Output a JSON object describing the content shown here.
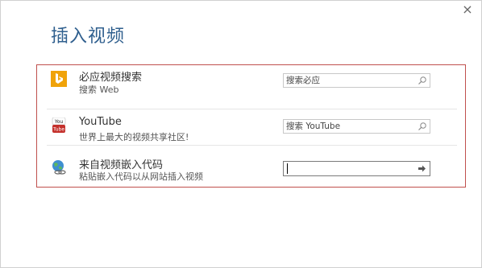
{
  "dialog": {
    "title": "插入视频",
    "close_glyph": "×"
  },
  "sources": [
    {
      "name": "必应视频搜索",
      "description": "搜索 Web",
      "icon": "bing-icon",
      "placeholder": "搜索必应",
      "action_icon": "search-icon"
    },
    {
      "name": "YouTube",
      "description": "世界上最大的视频共享社区!",
      "icon": "youtube-icon",
      "placeholder": "搜索 YouTube",
      "action_icon": "search-icon"
    },
    {
      "name": "来自视频嵌入代码",
      "description": "粘贴嵌入代码以从网站插入视频",
      "icon": "globe-link-icon",
      "placeholder": "",
      "action_icon": "arrow-right-icon"
    }
  ],
  "colors": {
    "title": "#2f5f8e",
    "panel_border": "#c0504d",
    "bing": "#f0a30a",
    "youtube": "#c4302b"
  }
}
